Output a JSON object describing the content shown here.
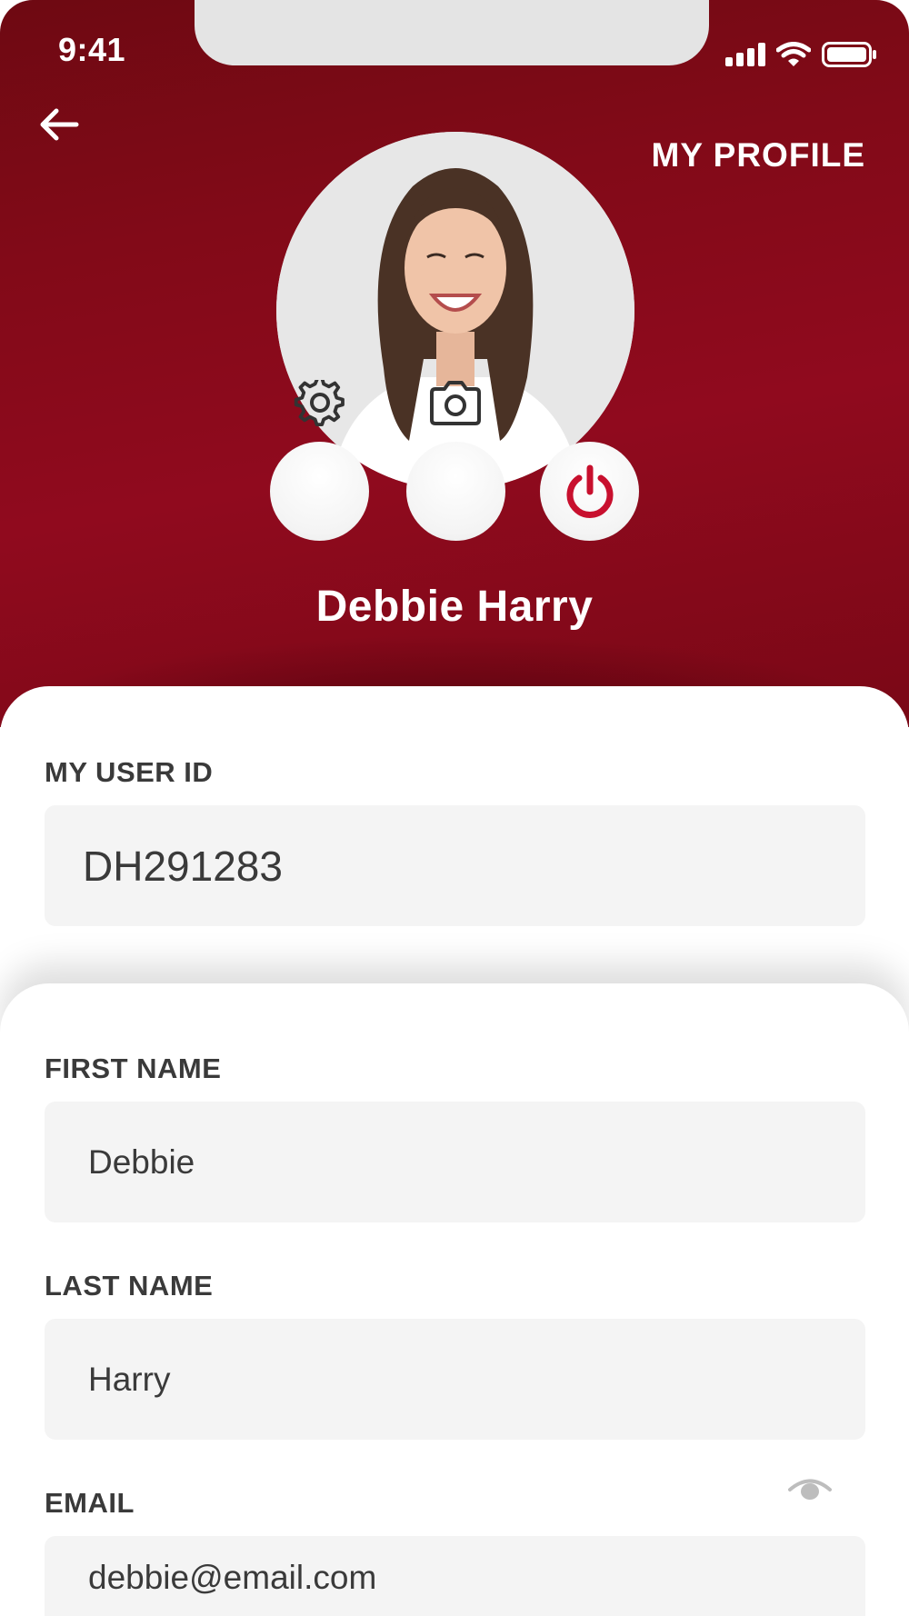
{
  "status_bar": {
    "time": "9:41"
  },
  "header": {
    "title": "MY PROFILE",
    "background_color": "#8a0a1c"
  },
  "profile": {
    "name": "Debbie Harry"
  },
  "accent_color": "#c8102e",
  "user_id": {
    "label": "MY USER ID",
    "value": "DH291283"
  },
  "form": {
    "first_name": {
      "label": "FIRST NAME",
      "value": "Debbie"
    },
    "last_name": {
      "label": "LAST NAME",
      "value": "Harry"
    },
    "email": {
      "label": "EMAIL",
      "value": "debbie@email.com"
    }
  },
  "icons": [
    "back-arrow-icon",
    "settings-gear-icon",
    "camera-icon",
    "power-icon",
    "eye-icon",
    "signal-icon",
    "wifi-icon",
    "battery-icon"
  ]
}
